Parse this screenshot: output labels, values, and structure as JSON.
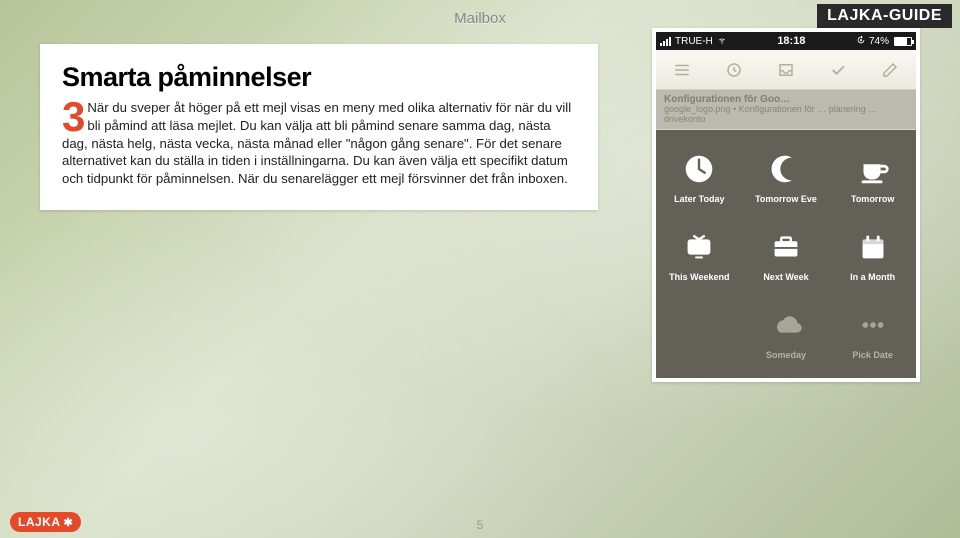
{
  "header": {
    "app_title": "Mailbox",
    "guide_badge": "LAJKA-GUIDE"
  },
  "article": {
    "title": "Smarta påminnelser",
    "step_number": "3",
    "body": "När du sveper åt höger på ett mejl visas en meny med olika alternativ för när du vill bli påmind att läsa mejlet. Du kan välja att bli påmind senare samma dag, nästa dag, nästa helg, nästa vecka, nästa månad eller \"någon gång senare\". För det senare alternativet kan du ställa in tiden i inställningarna. Du kan även välja ett specifikt datum och tidpunkt för påminnelsen. När du senarelägger ett mejl försvinner det från inboxen."
  },
  "phone": {
    "statusbar": {
      "carrier": "TRUE-H",
      "time": "18:18",
      "battery_pct": "74%"
    },
    "email_peek": {
      "subject": "Konfigurationen för Goo…",
      "preview": "google_logo.png • Konfigurationen för … planering … drivekonto"
    },
    "snooze_options": [
      {
        "label": "Later Today",
        "icon": "clock-icon"
      },
      {
        "label": "Tomorrow Eve",
        "icon": "moon-icon"
      },
      {
        "label": "Tomorrow",
        "icon": "cup-icon"
      },
      {
        "label": "This Weekend",
        "icon": "tv-icon"
      },
      {
        "label": "Next Week",
        "icon": "briefcase-icon"
      },
      {
        "label": "In a Month",
        "icon": "calendar-icon"
      },
      {
        "label": "Someday",
        "icon": "cloud-icon"
      },
      {
        "label": "Pick Date",
        "icon": "dots-icon"
      }
    ]
  },
  "footer": {
    "logo": "LAJKA",
    "page_number": "5"
  }
}
